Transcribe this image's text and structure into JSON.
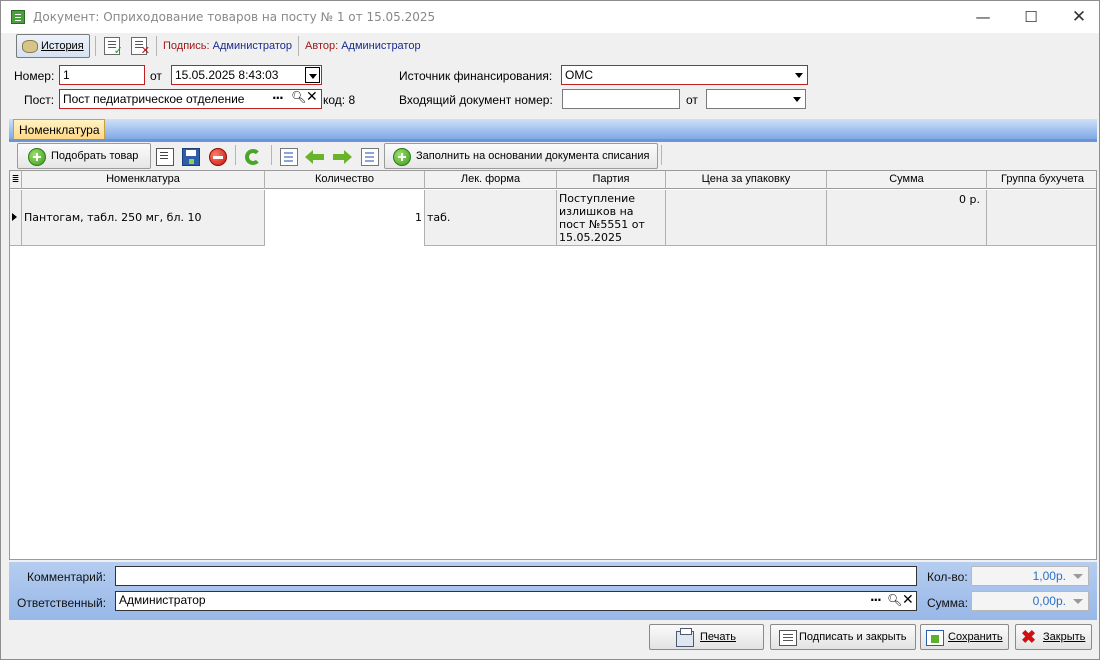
{
  "window": {
    "title": "Документ: Оприходование товаров на посту № 1 от 15.05.2025",
    "minimize": "—",
    "maximize": "☐",
    "close": "✕"
  },
  "toolbar": {
    "history_label": "История",
    "sign_label": "Подпись:",
    "sign_value": "Администратор",
    "author_label": "Автор:",
    "author_value": "Администратор"
  },
  "form": {
    "number_label": "Номер:",
    "number_value": "1",
    "from_label": "от",
    "date_value": "15.05.2025 8:43:03",
    "post_label": "Пост:",
    "post_value": "Пост педиатрическое отделение",
    "code_label": "код: 8",
    "funding_label": "Источник финансирования:",
    "funding_value": "ОМС",
    "incoming_label": "Входящий документ номер:",
    "incoming_value": "",
    "incoming_from_label": "от",
    "incoming_date_value": ""
  },
  "tabs": [
    {
      "label": "Номенклатура",
      "active": true
    }
  ],
  "items_toolbar": {
    "pick_label": "Подобрать товар",
    "fill_label": "Заполнить на основании документа списания"
  },
  "grid": {
    "columns": [
      "Номенклатура",
      "Количество",
      "Лек. форма",
      "Партия",
      "Цена за упаковку",
      "Сумма",
      "Группа бухучета"
    ],
    "rows": [
      {
        "name": "Пантогам, табл. 250 мг, бл. 10",
        "qty": "1",
        "form": "таб.",
        "batch": "Поступление излишков на пост №5551 от 15.05.2025",
        "price": "",
        "sum": "0 р.",
        "group": ""
      }
    ]
  },
  "bottom": {
    "comment_label": "Комментарий:",
    "comment_value": "",
    "responsible_label": "Ответственный:",
    "responsible_value": "Администратор",
    "count_label": "Кол-во:",
    "count_value": "1,00р.",
    "sum_label": "Сумма:",
    "sum_value": "0,00р."
  },
  "footer": {
    "print_label": "Печать",
    "sign_close_label": "Подписать и закрыть",
    "save_label": "Сохранить",
    "close_label": "Закрыть"
  },
  "colors": {
    "required_border": "#c02020",
    "tab_active": "#ffd886",
    "bottom_panel": "#a8c4ec",
    "value_blue": "#2a70c8"
  }
}
